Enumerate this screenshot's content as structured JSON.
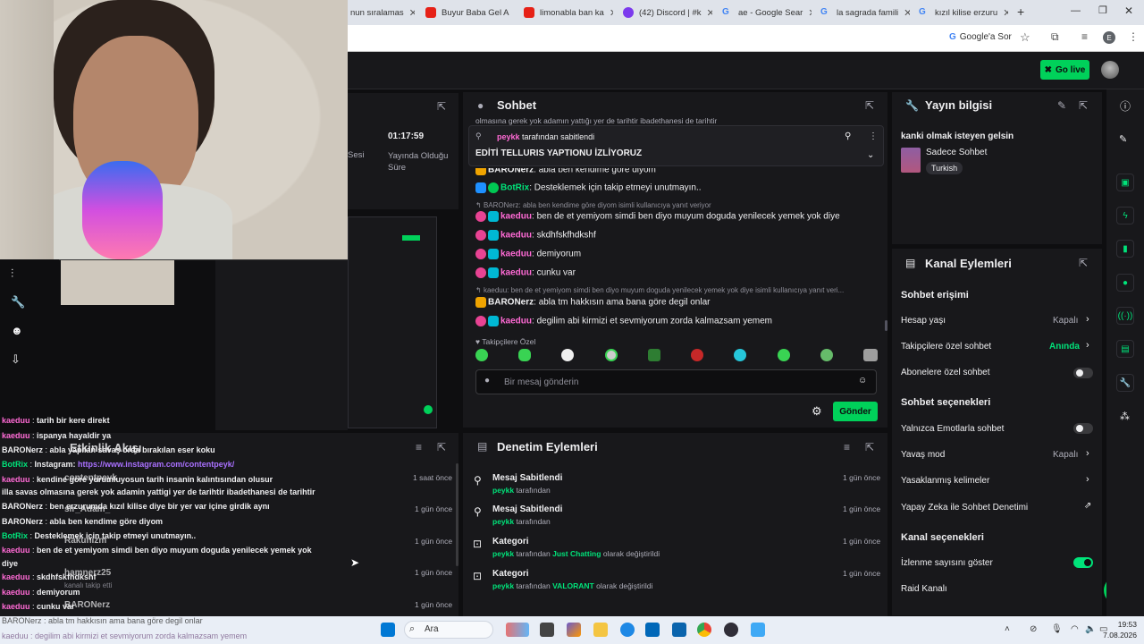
{
  "browser": {
    "tabs": [
      {
        "label": "nun sıralamas",
        "color": "#9aa0a6"
      },
      {
        "label": "Buyur Baba Gel A",
        "color": "#e62117"
      },
      {
        "label": "limonabla ban ka",
        "color": "#e62117"
      },
      {
        "label": "(42) Discord | #k",
        "color": "#7c3aed"
      },
      {
        "label": "ae - Google Sear",
        "color": "#4285f4"
      },
      {
        "label": "la sagrada famili",
        "color": "#4285f4"
      },
      {
        "label": "kızıl kilise erzuru",
        "color": "#4285f4"
      }
    ],
    "google_lens_label": "Google'a Sor",
    "profile_initial": "E"
  },
  "header": {
    "go_live_label": "Go live"
  },
  "stream_stats": {
    "time": "01:17:59",
    "time_label": "Yayında Olduğu Süre",
    "partial_label": "Sesi"
  },
  "chat": {
    "title": "Sohbet",
    "pinned_by_user": "peykk",
    "pinned_by_suffix": "tarafından sabitlendi",
    "pinned_message": "EDİTİ TELLURIS YAPTIONU İZLİYORUZ",
    "top_cut": "olmasına gerek yok adamın yattığı yer de tarihtir ibadethanesi de tarihtir",
    "messages": [
      {
        "user": "BARONerz",
        "text": "abla ben kendime göre diyom",
        "ucolor": "#efeff1"
      },
      {
        "user": "BotRix",
        "text": "Desteklemek için takip etmeyi unutmayın..",
        "ucolor": "#00e37a"
      },
      {
        "reply": "BARONerz: abla ben kendime göre diyom isimli kullanıcıya yanıt veriyor"
      },
      {
        "user": "kaeduu",
        "text": "ben de et yemiyom simdi ben diyo muyum doguda yenilecek yemek yok diye",
        "ucolor": "#ff6ad5"
      },
      {
        "user": "kaeduu",
        "text": "skdhfskfhdkshf",
        "ucolor": "#ff6ad5"
      },
      {
        "user": "kaeduu",
        "text": "demiyorum",
        "ucolor": "#ff6ad5"
      },
      {
        "user": "kaeduu",
        "text": "cunku var",
        "ucolor": "#ff6ad5"
      },
      {
        "reply": "kaeduu: ben de et yemiyom simdi ben diyo muyum doguda yenilecek yemek yok diye isimli kullanıcıya yanıt veri..."
      },
      {
        "user": "BARONerz",
        "text": "abla tm hakkısın ama bana göre degil onlar",
        "ucolor": "#efeff1"
      },
      {
        "user": "kaeduu",
        "text": "degilim abi kirmizi et sevmiyorum zorda kalmazsam yemem",
        "ucolor": "#ff6ad5"
      }
    ],
    "followers_only": "Takipçilere Özel",
    "input_placeholder": "Bir mesaj gönderin",
    "send_label": "Gönder"
  },
  "stream_info": {
    "title": "Yayın bilgisi",
    "stream_title": "kanki olmak isteyen gelsin",
    "category": "Sadece Sohbet",
    "language": "Turkish"
  },
  "channel_actions": {
    "title": "Kanal Eylemleri",
    "chat_access": "Sohbet erişimi",
    "account_age": "Hesap yaşı",
    "account_age_value": "Kapalı",
    "followers_chat": "Takipçilere özel sohbet",
    "followers_chat_value": "Anında",
    "subs_chat": "Abonelere özel sohbet",
    "chat_options": "Sohbet seçenekleri",
    "emote_only": "Yalnızca Emotlarla sohbet",
    "slow_mode": "Yavaş mod",
    "slow_mode_value": "Kapalı",
    "banned_words": "Yasaklanmış kelimeler",
    "ai_moderation": "Yapay Zeka ile Sohbet Denetimi",
    "channel_options": "Kanal seçenekleri",
    "show_viewers": "İzlenme sayısını göster",
    "raid": "Raid Kanalı"
  },
  "activity": {
    "title": "Etkinlik Akışı"
  },
  "mod_actions": {
    "title": "Denetim Eylemleri",
    "items": [
      {
        "title": "Mesaj Sabitlendi",
        "user": "peykk",
        "suffix": "tarafından",
        "time": "1 gün önce"
      },
      {
        "title": "Mesaj Sabitlendi",
        "user": "peykk",
        "suffix": "tarafından",
        "time": "1 gün önce"
      },
      {
        "title": "Kategori",
        "user": "peykk",
        "suffix": "tarafından",
        "value": "Just Chatting",
        "tail": "olarak değiştirildi",
        "time": "1 gün önce"
      },
      {
        "title": "Kategori",
        "user": "peykk",
        "suffix": "tarafından",
        "value": "VALORANT",
        "tail": "olarak değiştirildi",
        "time": "1 gün önce"
      }
    ]
  },
  "activity_times": [
    "1 saat önce",
    "1 gün önce",
    "1 gün önce",
    "1 gün önce",
    "1 gün önce"
  ],
  "overlay_chat": [
    {
      "user": "kaeduu",
      "text": "tarih bir kere direkt",
      "ucolor": "#ff6ad5"
    },
    {
      "user": "kaeduu",
      "text": "ispanya hayaldir ya",
      "ucolor": "#ff6ad5"
    },
    {
      "user": "BARONerz",
      "text": "abla yapılan savaş orda bırakılan eser koku",
      "ucolor": "#efeff1"
    },
    {
      "user": "BotRix",
      "text": "Instagram:",
      "link": "https://www.instagram.com/contentpeyk/",
      "ucolor": "#00e37a"
    },
    {
      "user": "kaeduu",
      "text": "kendine gore yorumluyosun tarih insanin kalıntısından olusur",
      "ucolor": "#ff6ad5"
    },
    {
      "user": "",
      "text": "illa savas olmasına gerek yok adamin yattigi yer de tarihtir ibadethanesi de tarihtir",
      "ucolor": "#efeff1"
    },
    {
      "user": "BARONerz",
      "text": "ben erzurumda kızıl kilise diye bir yer var içine girdik aynı",
      "ucolor": "#efeff1"
    },
    {
      "user": "BARONerz",
      "text": "abla ben kendime göre diyom",
      "ucolor": "#efeff1"
    },
    {
      "user": "BotRix",
      "text": "Desteklemek için takip etmeyi unutmayın..",
      "ucolor": "#00e37a"
    },
    {
      "user": "kaeduu",
      "text": "ben de et yemiyom simdi ben diyo muyum doguda yenilecek yemek yok",
      "ucolor": "#ff6ad5"
    },
    {
      "user": "",
      "text": "diye",
      "ucolor": "#efeff1"
    },
    {
      "user": "kaeduu",
      "text": "skdhfskfhdkshf",
      "ucolor": "#ff6ad5"
    },
    {
      "user": "kaeduu",
      "text": "demiyorum",
      "ucolor": "#ff6ad5"
    },
    {
      "user": "kaeduu",
      "text": "cunku var",
      "ucolor": "#ff6ad5"
    },
    {
      "user": "BARONerz",
      "text": "abla tm hakkısın ama bana göre degil onlar",
      "ucolor": "#efeff1"
    },
    {
      "user": "kaeduu",
      "text": "degilim abi kirmizi et sevmiyorum zorda kalmazsam yemem",
      "ucolor": "#ff6ad5"
    }
  ],
  "activity_names": [
    "contentpeyk",
    "sir_Adam_",
    "Rakunizm",
    "hamnerz25",
    "BARONerz"
  ],
  "activity_follow": "kanalı takip etti",
  "taskbar": {
    "search": "Ara",
    "time": "19:53",
    "date": "7.08.2026"
  }
}
